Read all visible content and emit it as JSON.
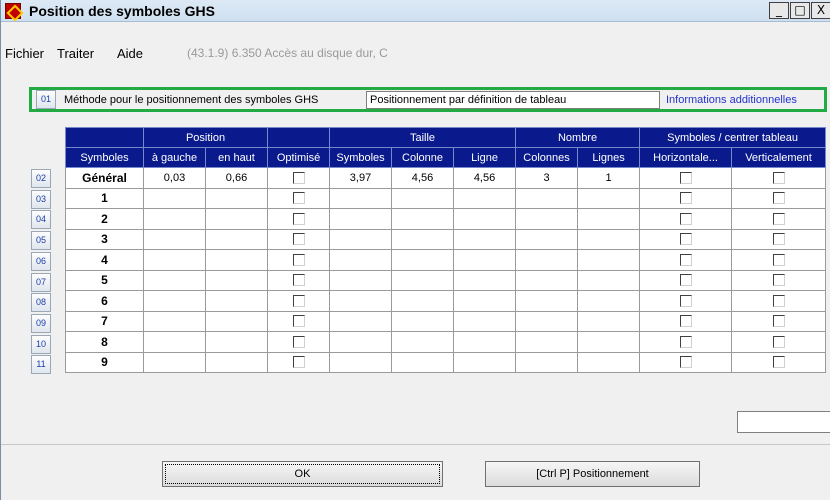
{
  "window": {
    "title": "Position des symboles GHS",
    "controls": [
      "_",
      "□",
      "X"
    ]
  },
  "menu": {
    "items": [
      "Fichier",
      "Traiter",
      "Aide"
    ],
    "info": "(43.1.9) 6.350 Accès au disque dur, C"
  },
  "method": {
    "num": "01",
    "label": "Méthode pour le positionnement des symboles GHS",
    "value": "Positionnement par définition de tableau",
    "link": "Informations additionnelles"
  },
  "table": {
    "group_headers": [
      "Position",
      "Taille",
      "Nombre",
      "Symboles / centrer tableau"
    ],
    "columns": [
      "Symboles",
      "à gauche",
      "en haut",
      "Optimisé",
      "Symboles",
      "Colonne",
      "Ligne",
      "Colonnes",
      "Lignes",
      "Horizontale...",
      "Verticalement"
    ],
    "rows": [
      {
        "num": "02",
        "label": "Général",
        "gauche": "0,03",
        "haut": "0,66",
        "taille_symboles": "3,97",
        "colonne": "4,56",
        "ligne": "4,56",
        "colonnes": "3",
        "lignes": "1"
      },
      {
        "num": "03",
        "label": "1",
        "gauche": "",
        "haut": "",
        "taille_symboles": "",
        "colonne": "",
        "ligne": "",
        "colonnes": "",
        "lignes": ""
      },
      {
        "num": "04",
        "label": "2",
        "gauche": "",
        "haut": "",
        "taille_symboles": "",
        "colonne": "",
        "ligne": "",
        "colonnes": "",
        "lignes": ""
      },
      {
        "num": "05",
        "label": "3",
        "gauche": "",
        "haut": "",
        "taille_symboles": "",
        "colonne": "",
        "ligne": "",
        "colonnes": "",
        "lignes": ""
      },
      {
        "num": "06",
        "label": "4",
        "gauche": "",
        "haut": "",
        "taille_symboles": "",
        "colonne": "",
        "ligne": "",
        "colonnes": "",
        "lignes": ""
      },
      {
        "num": "07",
        "label": "5",
        "gauche": "",
        "haut": "",
        "taille_symboles": "",
        "colonne": "",
        "ligne": "",
        "colonnes": "",
        "lignes": ""
      },
      {
        "num": "08",
        "label": "6",
        "gauche": "",
        "haut": "",
        "taille_symboles": "",
        "colonne": "",
        "ligne": "",
        "colonnes": "",
        "lignes": ""
      },
      {
        "num": "09",
        "label": "7",
        "gauche": "",
        "haut": "",
        "taille_symboles": "",
        "colonne": "",
        "ligne": "",
        "colonnes": "",
        "lignes": ""
      },
      {
        "num": "10",
        "label": "8",
        "gauche": "",
        "haut": "",
        "taille_symboles": "",
        "colonne": "",
        "ligne": "",
        "colonnes": "",
        "lignes": ""
      },
      {
        "num": "11",
        "label": "9",
        "gauche": "",
        "haut": "",
        "taille_symboles": "",
        "colonne": "",
        "ligne": "",
        "colonnes": "",
        "lignes": ""
      }
    ]
  },
  "buttons": {
    "ok": "OK",
    "positionnement": "[Ctrl P] Positionnement"
  },
  "colors": {
    "header_bg": "#0a1a8c",
    "frame_green": "#22aa44",
    "link_blue": "#2233cc"
  }
}
